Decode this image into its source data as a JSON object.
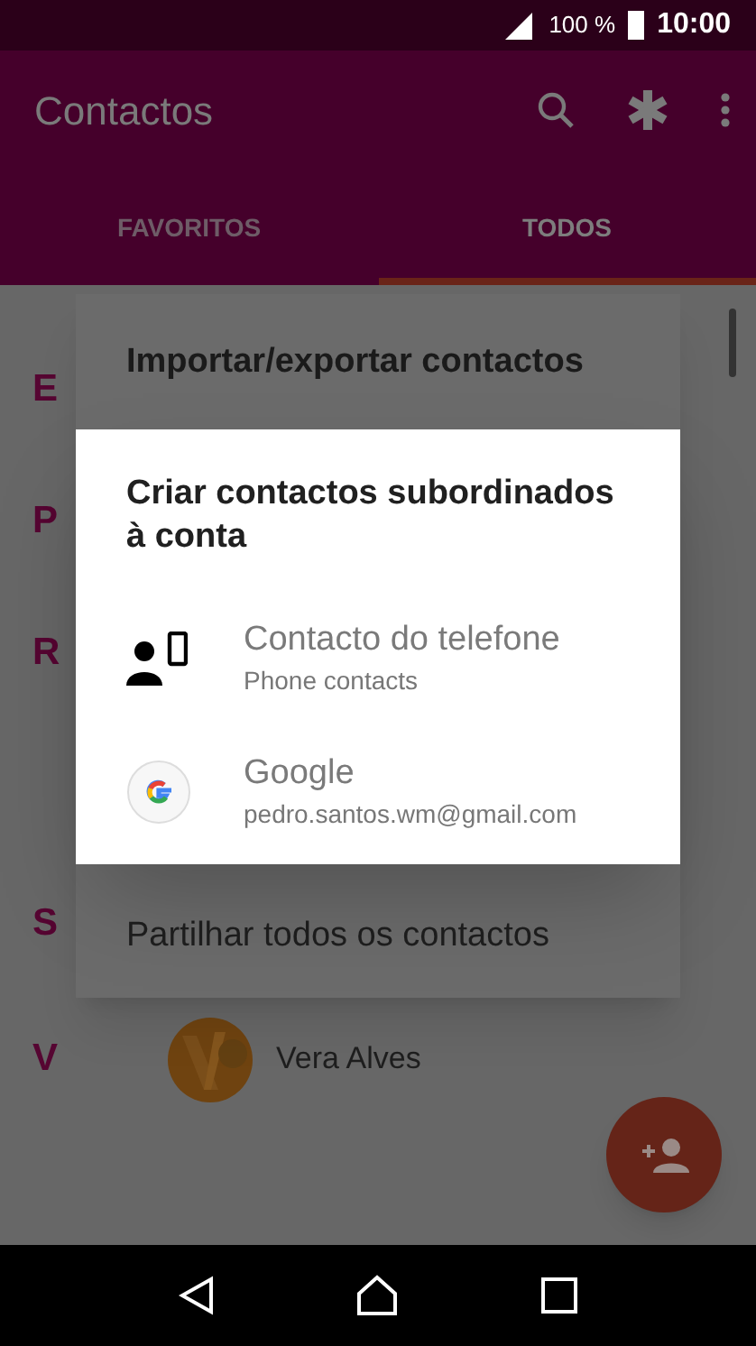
{
  "status_bar": {
    "battery": "100 %",
    "time": "10:00"
  },
  "app_bar": {
    "title": "Contactos"
  },
  "tabs": [
    {
      "label": "FAVORITOS",
      "selected": false
    },
    {
      "label": "TODOS",
      "selected": true
    }
  ],
  "contacts": [
    {
      "letter": "E"
    },
    {
      "letter": "P"
    },
    {
      "letter": "R"
    },
    {
      "letter": "S"
    },
    {
      "letter": "V",
      "name": "Vera Alves"
    }
  ],
  "menu": {
    "items": [
      "Importar/exportar contactos",
      "Partilhar todos os contactos"
    ]
  },
  "dialog": {
    "title": "Criar contactos subordinados à conta",
    "accounts": [
      {
        "kind": "phone",
        "name": "Contacto do telefone",
        "detail": "Phone contacts"
      },
      {
        "kind": "google",
        "name": "Google",
        "detail": "pedro.santos.wm@gmail.com"
      }
    ]
  }
}
